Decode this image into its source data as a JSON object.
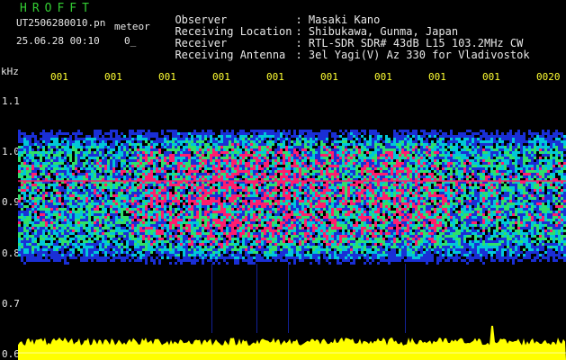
{
  "header": {
    "app_title": "HROFFT",
    "filename": "UT2506280010.pn",
    "meteor_label": "meteor",
    "datetime": "25.06.28 00:10",
    "counter": "0_"
  },
  "info": [
    {
      "label": "Observer",
      "value": ": Masaki Kano"
    },
    {
      "label": "Receiving Location",
      "value": ": Shibukawa, Gunma, Japan"
    },
    {
      "label": "Receiver",
      "value": ": RTL-SDR SDR# 43dB L15 103.2MHz CW"
    },
    {
      "label": "Receiving Antenna",
      "value": ": 3el Yagi(V) Az 330 for Vladivostok"
    }
  ],
  "chart_data": {
    "type": "heatmap",
    "ylabel": "kHz",
    "y_ticks": [
      "1.1",
      "1.0",
      "0.9",
      "0.8",
      "0.7",
      "0.6"
    ],
    "ylim": [
      0.59,
      1.13
    ],
    "x_ticks": [
      "001",
      "001",
      "001",
      "001",
      "001",
      "001",
      "001",
      "001",
      "001",
      "0020"
    ],
    "signal_band_khz": [
      0.78,
      1.05
    ],
    "colors": {
      "background": "#000000",
      "low": "#1a2fd6",
      "mid": "#00c8d8",
      "high": "#2ee06a",
      "peak": "#ff1e6e",
      "power_trace": "#ffff00",
      "tick_label": "#ffff33",
      "text": "#e8e8e8",
      "title": "#33cc33"
    }
  }
}
